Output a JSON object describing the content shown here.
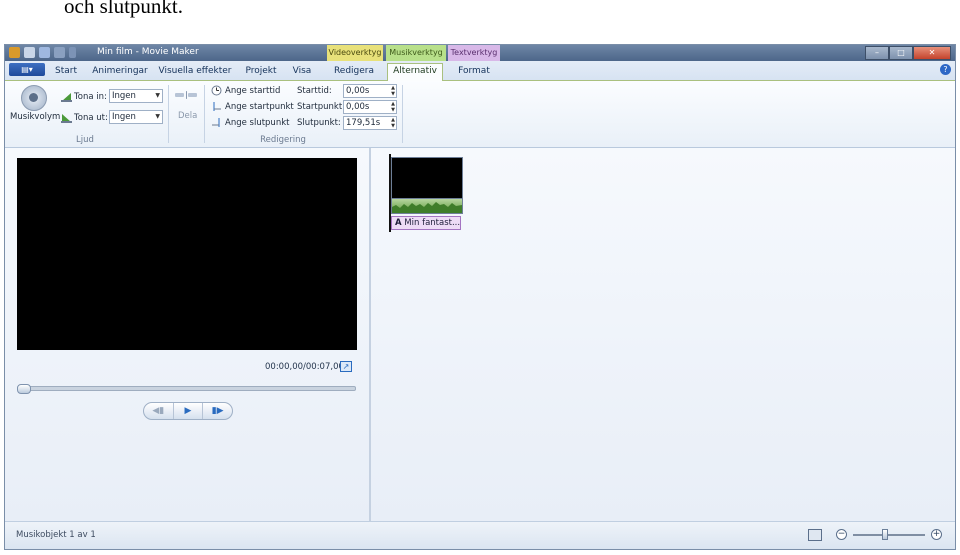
{
  "document": {
    "caption": "och slutpunkt."
  },
  "window": {
    "title": "Min film - Movie Maker"
  },
  "context_tabs": {
    "video": "Videoverktyg",
    "music": "Musikverktyg",
    "text": "Textverktyg"
  },
  "tabs": [
    {
      "label": "Start"
    },
    {
      "label": "Animeringar"
    },
    {
      "label": "Visuella effekter"
    },
    {
      "label": "Projekt"
    },
    {
      "label": "Visa"
    },
    {
      "label": "Redigera"
    },
    {
      "label": "Alternativ"
    },
    {
      "label": "Format"
    }
  ],
  "active_tab": "Alternativ",
  "ribbon": {
    "ljud": {
      "group_label": "Ljud",
      "music_volume_label": "Musikvolym",
      "fade_in_label": "Tona in:",
      "fade_in_value": "Ingen",
      "fade_out_label": "Tona ut:",
      "fade_out_value": "Ingen"
    },
    "split_label": "Dela",
    "redigering": {
      "group_label": "Redigering",
      "set_start_time": "Ange starttid",
      "set_start_point": "Ange startpunkt",
      "set_end_point": "Ange slutpunkt",
      "start_time_label": "Starttid:",
      "start_time_value": "0,00s",
      "start_point_label": "Startpunkt:",
      "start_point_value": "0,00s",
      "end_point_label": "Slutpunkt:",
      "end_point_value": "179,51s"
    }
  },
  "preview": {
    "timecode": "00:00,00/00:07,00",
    "seek_fraction": 0
  },
  "storyboard": {
    "clip_caption": "Min fantast..."
  },
  "status": {
    "text": "Musikobjekt 1 av 1",
    "zoom_fraction": 0.45
  },
  "colors": {
    "active_tab_border": "#a9c07f",
    "accent_blue": "#2a6bbf"
  }
}
